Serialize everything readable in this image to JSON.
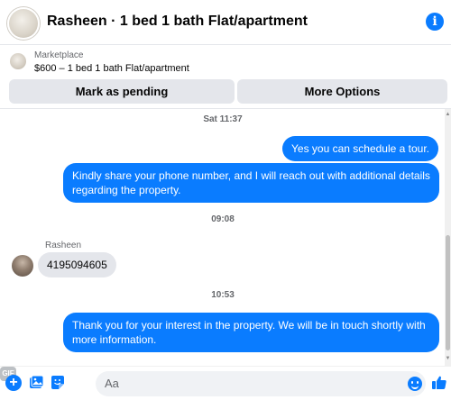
{
  "header": {
    "title": "Rasheen · 1 bed 1 bath Flat/apartment",
    "info_icon": "info-icon"
  },
  "listing": {
    "source": "Marketplace",
    "title": "$600 – 1 bed 1 bath Flat/apartment"
  },
  "actions": {
    "mark_pending": "Mark as pending",
    "more_options": "More Options"
  },
  "messages": {
    "timestamp_1": "Sat 11:37",
    "out_1": "Yes you can schedule a tour.",
    "out_2": "Kindly share your phone number, and I will reach out with additional details regarding the property.",
    "timestamp_2": "09:08",
    "sender_name": "Rasheen",
    "in_1": "4195094605",
    "timestamp_3": "10:53",
    "out_3": "Thank you for your interest in the property. We will be in touch shortly with more information."
  },
  "composer": {
    "placeholder": "Aa",
    "gif_label": "GIF",
    "plus_label": "+",
    "icons": [
      "plus-icon",
      "photo-icon",
      "sticker-icon",
      "gif-icon",
      "emoji-icon",
      "like-icon"
    ]
  },
  "colors": {
    "accent": "#0a7cff",
    "bubble_incoming": "#e4e6eb",
    "button_bg": "#e4e6eb"
  }
}
